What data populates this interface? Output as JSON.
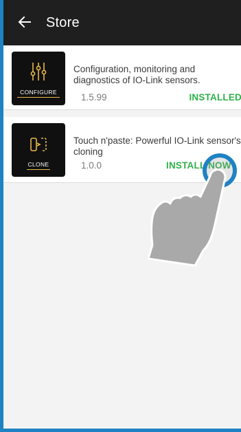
{
  "header": {
    "title": "Store",
    "back_icon": "arrow-left-icon"
  },
  "apps": [
    {
      "tile_label": "CONFIGURE",
      "tile_icon": "sliders-icon",
      "description": "Configuration, monitoring and diagnostics of IO-Link sensors.",
      "version": "1.5.99",
      "status": "INSTALLED"
    },
    {
      "tile_label": "CLONE",
      "tile_icon": "clone-icon",
      "description": "Touch n'paste: Powerful IO-Link sensor's cloning",
      "version": "1.0.0",
      "status": "INSTALL NOW"
    }
  ],
  "colors": {
    "accent": "#1e82c3",
    "topbar": "#1f1f1f",
    "status_green": "#2fb24a",
    "tile_gold": "#e8b84a"
  },
  "overlay": {
    "gesture_icon": "tap-hand-icon"
  }
}
